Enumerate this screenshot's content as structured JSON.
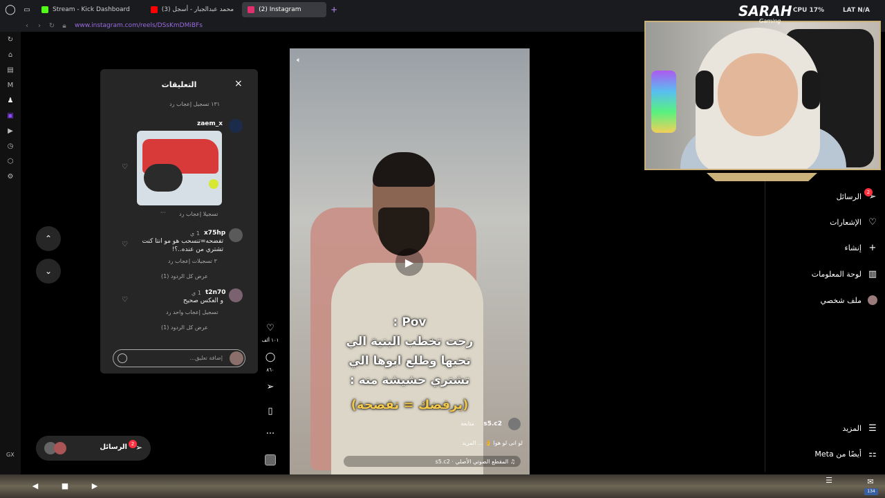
{
  "browser": {
    "tabs": [
      {
        "label": "Stream - Kick Dashboard",
        "color": "#53fc18"
      },
      {
        "label": "(3) محمد عبدالجبار - أسجل",
        "color": "#ff0000"
      },
      {
        "label": "(2) Instagram",
        "color": "#e1306c",
        "active": true
      }
    ],
    "add_tab": "+",
    "url": "www.instagram.com/reels/DSsKmDMiBFs",
    "cpu": "CPU 17%",
    "lat": "LAT N/A"
  },
  "comments": {
    "title": "التعليقات",
    "close": "×",
    "top_meta": "١٣١ تسجيل إعجاب   رد",
    "c1_user": "zaem_x",
    "c1_meta": "تسجيلا إعجاب   رد",
    "c1_more": "···",
    "c2_user": "x75hp",
    "c2_time": "1 ي",
    "c2_body1": "تفضحه=تنسحب هو مو انتا كنت",
    "c2_body2": "تشتري من عنده..؟!",
    "c2_meta": "٣ تسجيلات إعجاب   رد",
    "c2_replies": "عرض كل الردود (1)",
    "c3_user": "t2n70",
    "c3_time": "1 ي",
    "c3_body": "و العكس صحيح",
    "c3_meta": "تسجيل إعجاب واحد   رد",
    "c3_replies": "عرض كل الردود (1)",
    "input_placeholder": "إضافة تعليق..."
  },
  "video": {
    "caption_line1": "Pov :",
    "caption_line2": "رحت تخطب البنية الي",
    "caption_line3": "تحبها وطلع ابوها الي",
    "caption_line4": "تشتري حشيشة منه :",
    "caption_line5": "(يرفضك = تفضحة)",
    "user": "s5.c2",
    "follow": "متابعة",
    "desc": "لو انى لو هوا 👌 ... المزيد",
    "audio": "♫ المقطع الصوتي الأصلي · s5.c2"
  },
  "actions": {
    "like_count": "١٠١ ألف",
    "comment_count": "٨٦٠"
  },
  "sidebar": {
    "messages": "الرسائل",
    "messages_badge": "2",
    "notifications": "الإشعارات",
    "create": "إنشاء",
    "dashboard": "لوحة المعلومات",
    "profile": "ملف شخصي",
    "more": "المزيد",
    "meta": "أيضًا من Meta"
  },
  "messages_pill": {
    "label": "الرسائل",
    "badge": "2"
  },
  "overlay": {
    "logo": "SARAH",
    "logo_sub": "Gaming"
  },
  "taskbar": {
    "badge": "134"
  },
  "rail": {
    "gx": "GX"
  }
}
